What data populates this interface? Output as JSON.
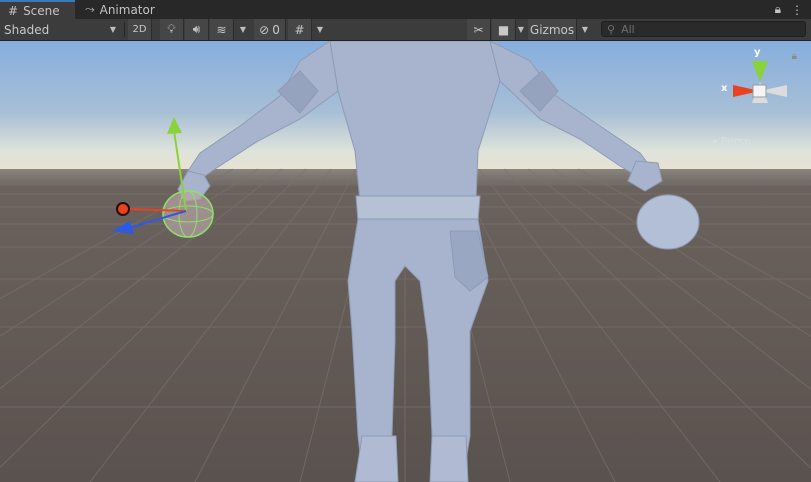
{
  "tabs": [
    {
      "label": "Scene",
      "icon": "hash-grid-icon",
      "active": true
    },
    {
      "label": "Animator",
      "icon": "animator-branch-icon",
      "active": false
    }
  ],
  "toolbar": {
    "draw_mode": "Shaded",
    "mode_2d": "2D",
    "hidden_count": "0",
    "gizmos": "Gizmos",
    "search_placeholder": "All"
  },
  "scene": {
    "projection": "Persp",
    "axis_x": "x",
    "axis_y": "y"
  },
  "colors": {
    "sky_top": "#8cb2dc",
    "ground": "#615955",
    "character": "#a7b3cc",
    "x_axis": "#e8421e",
    "y_axis": "#8bd13a",
    "z_axis": "#2d59e6"
  }
}
